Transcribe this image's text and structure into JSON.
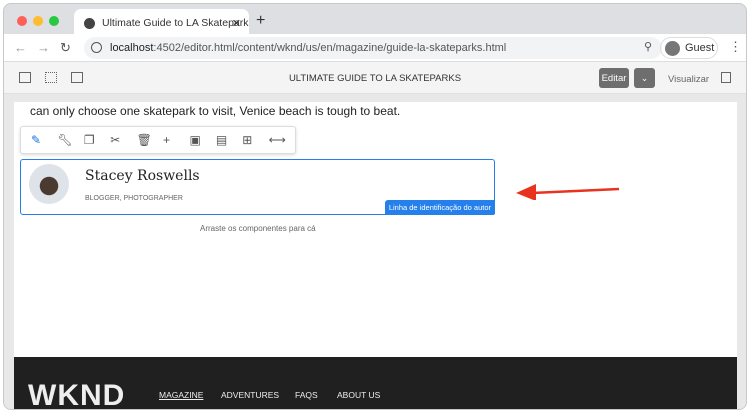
{
  "browser": {
    "tab_title": "Ultimate Guide to LA Skatepark",
    "url_host": "localhost",
    "url_path": ":4502/editor.html/content/wknd/us/en/magazine/guide-la-skateparks.html",
    "profile": "Guest"
  },
  "toolbar": {
    "page_title": "ULTIMATE GUIDE TO LA SKATEPARKS",
    "edit_label": "Editar",
    "preview_label": "Visualizar"
  },
  "content": {
    "paragraph": "can only choose one skatepark to visit, Venice beach is tough to beat.",
    "component_tools": [
      "edit",
      "configure",
      "copy",
      "cut",
      "delete",
      "insert",
      "group",
      "layout",
      "parent",
      "resize"
    ],
    "byline": {
      "name": "Stacey Roswells",
      "occupations": "BLOGGER, PHOTOGRAPHER",
      "component_label": "Linha de identificação do autor"
    },
    "drop_zone": "Arraste os componentes para cá"
  },
  "footer": {
    "logo": "WKND",
    "nav": [
      "MAGAZINE",
      "ADVENTURES",
      "FAQS",
      "ABOUT US"
    ]
  },
  "colors": {
    "accent": "#2680eb",
    "arrow": "#e8331f"
  }
}
